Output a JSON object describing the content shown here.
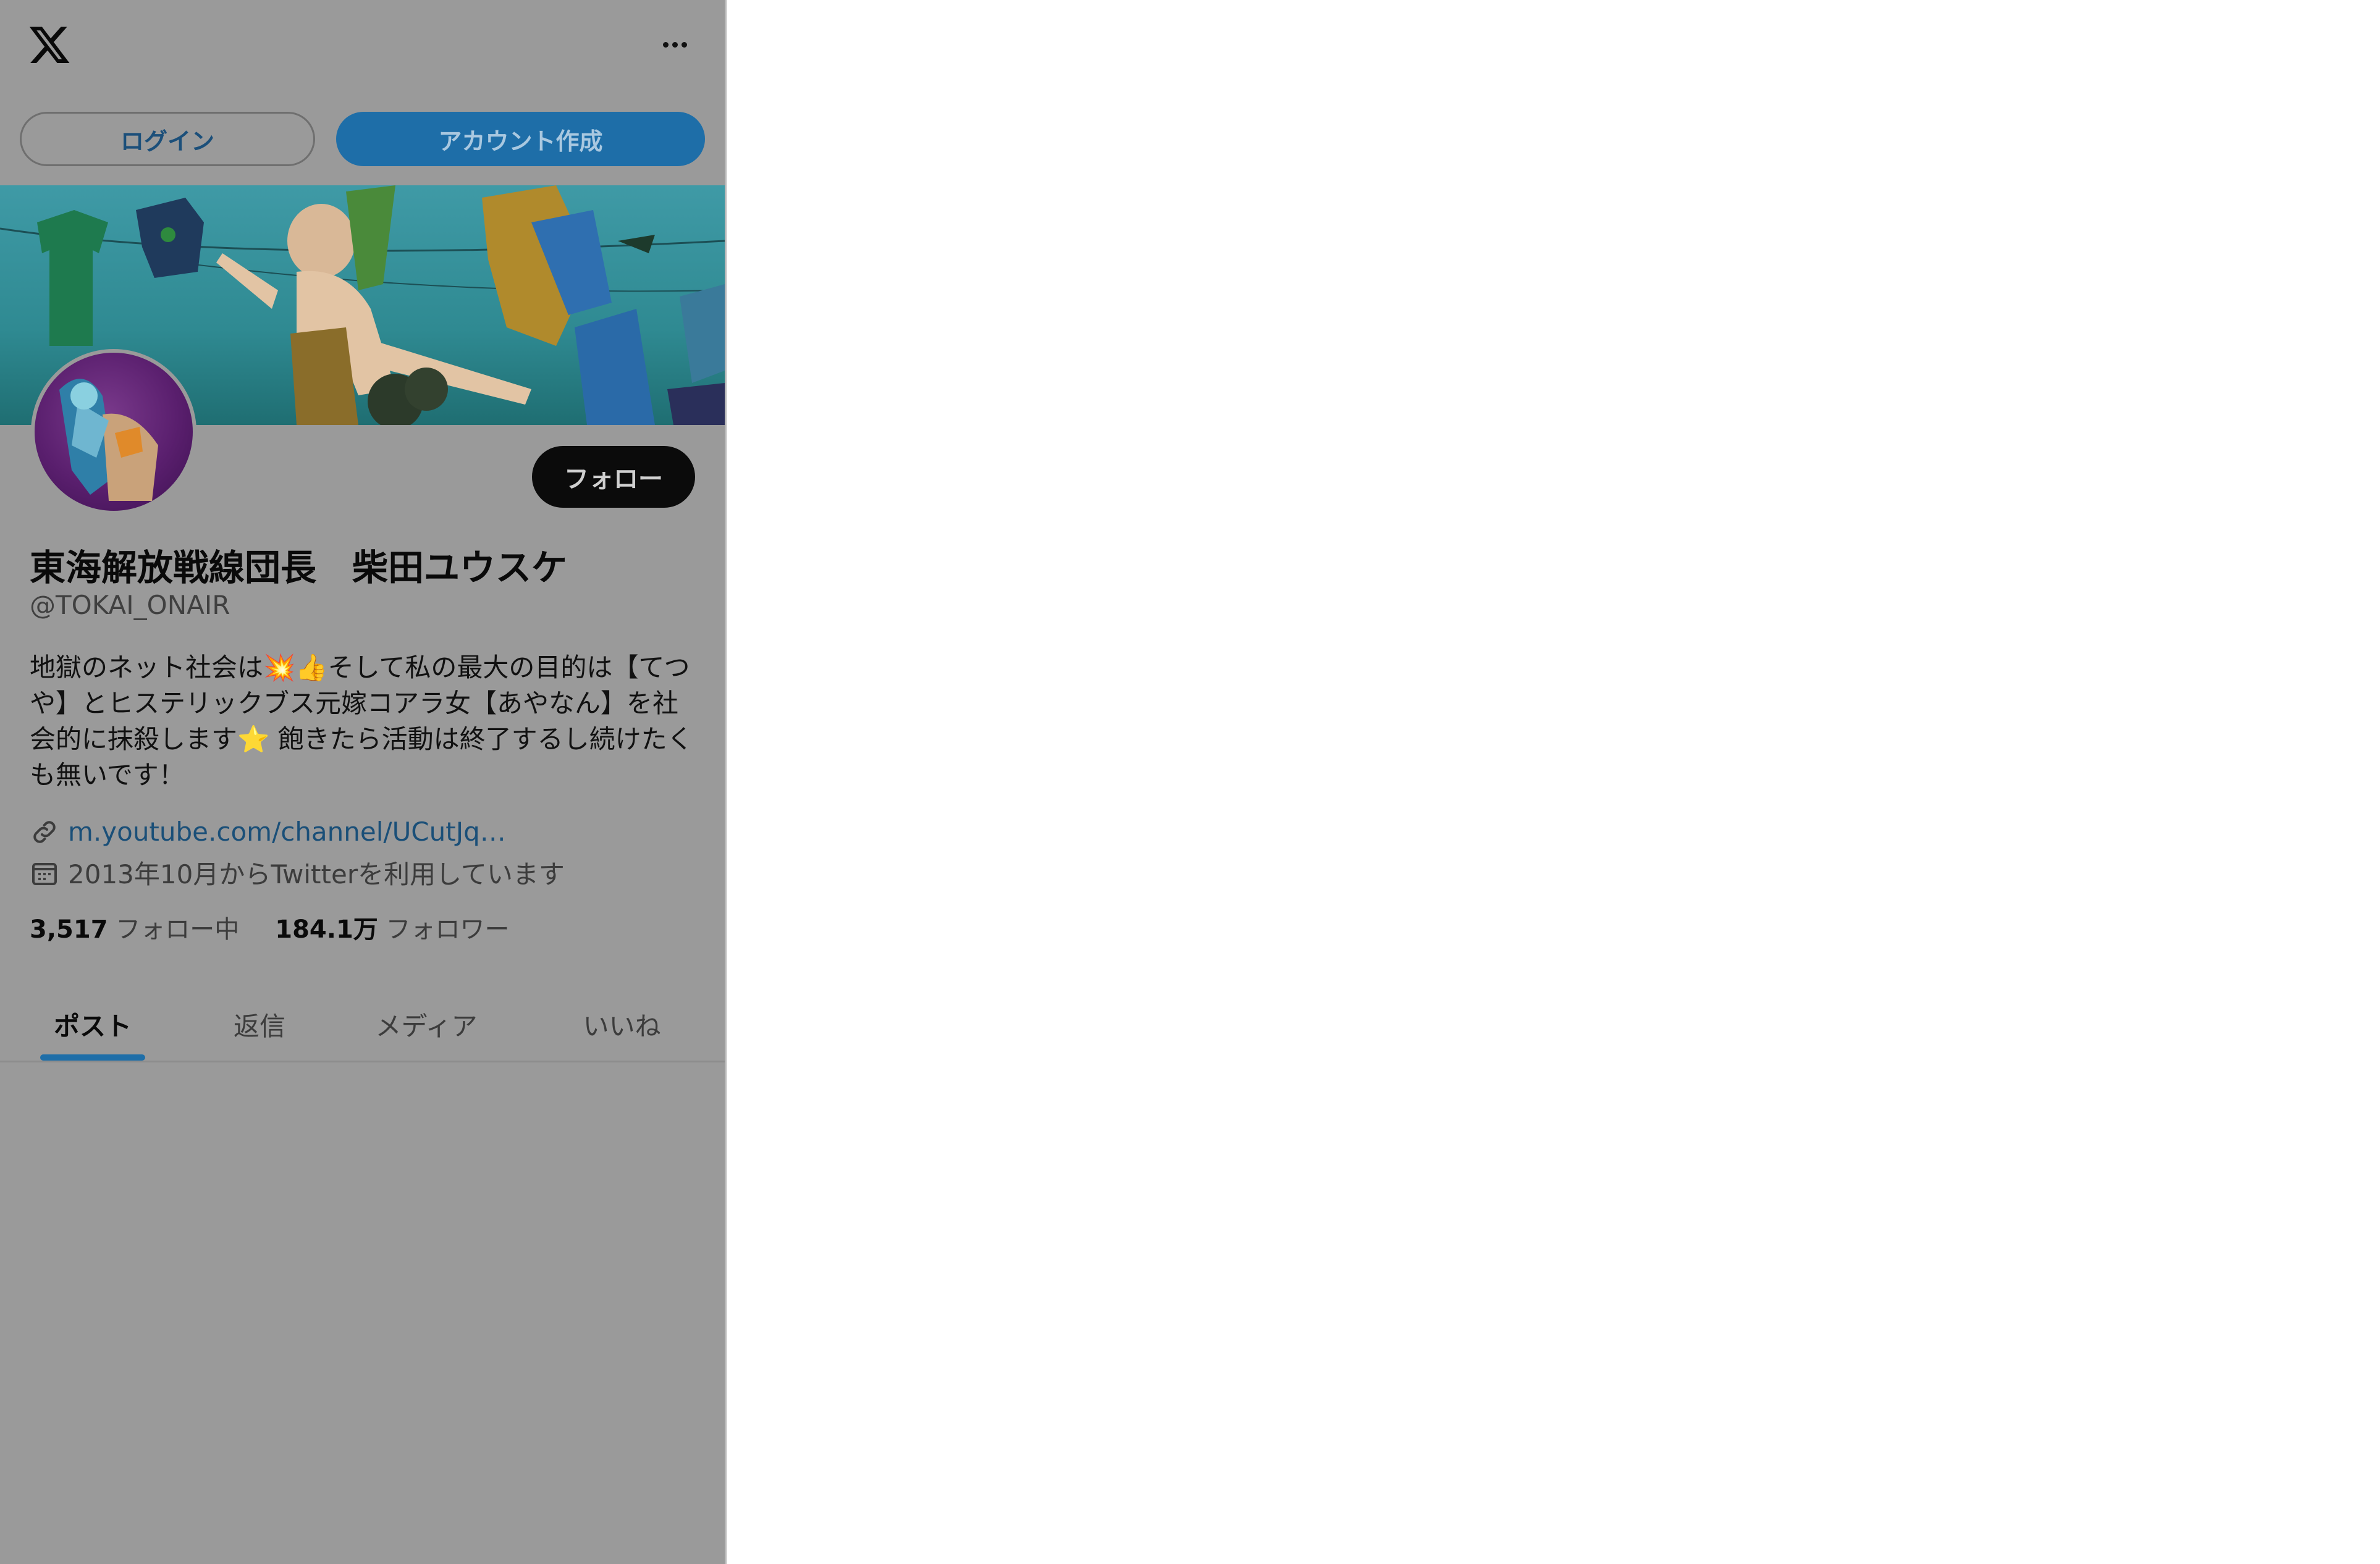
{
  "header": {
    "logo_icon": "x-logo-icon",
    "more_icon": "more-dots-icon"
  },
  "auth": {
    "login_label": "ログイン",
    "signup_label": "アカウント作成"
  },
  "profile": {
    "follow_label": "フォロー",
    "display_name": "東海解放戦線団長　柴田ユウスケ",
    "handle": "@TOKAI_ONAIR",
    "bio": "地獄のネット社会は💥👍そして私の最大の目的は【てつや】とヒステリックブス元嫁コアラ女【あやなん】を社会的に抹殺します⭐ 飽きたら活動は終了するし続けたくも無いです！",
    "link_text": "m.youtube.com/channel/UCutJq…",
    "joined_text": "2013年10月からTwitterを利用しています",
    "following_count": "3,517",
    "following_label": "フォロー中",
    "followers_count": "184.1万",
    "followers_label": "フォロワー"
  },
  "tabs": [
    {
      "label": "ポスト",
      "active": true
    },
    {
      "label": "返信",
      "active": false
    },
    {
      "label": "メディア",
      "active": false
    },
    {
      "label": "いいね",
      "active": false
    }
  ],
  "colors": {
    "accent": "#1e6ea8",
    "overlay_dim": "#9a9a9a"
  }
}
